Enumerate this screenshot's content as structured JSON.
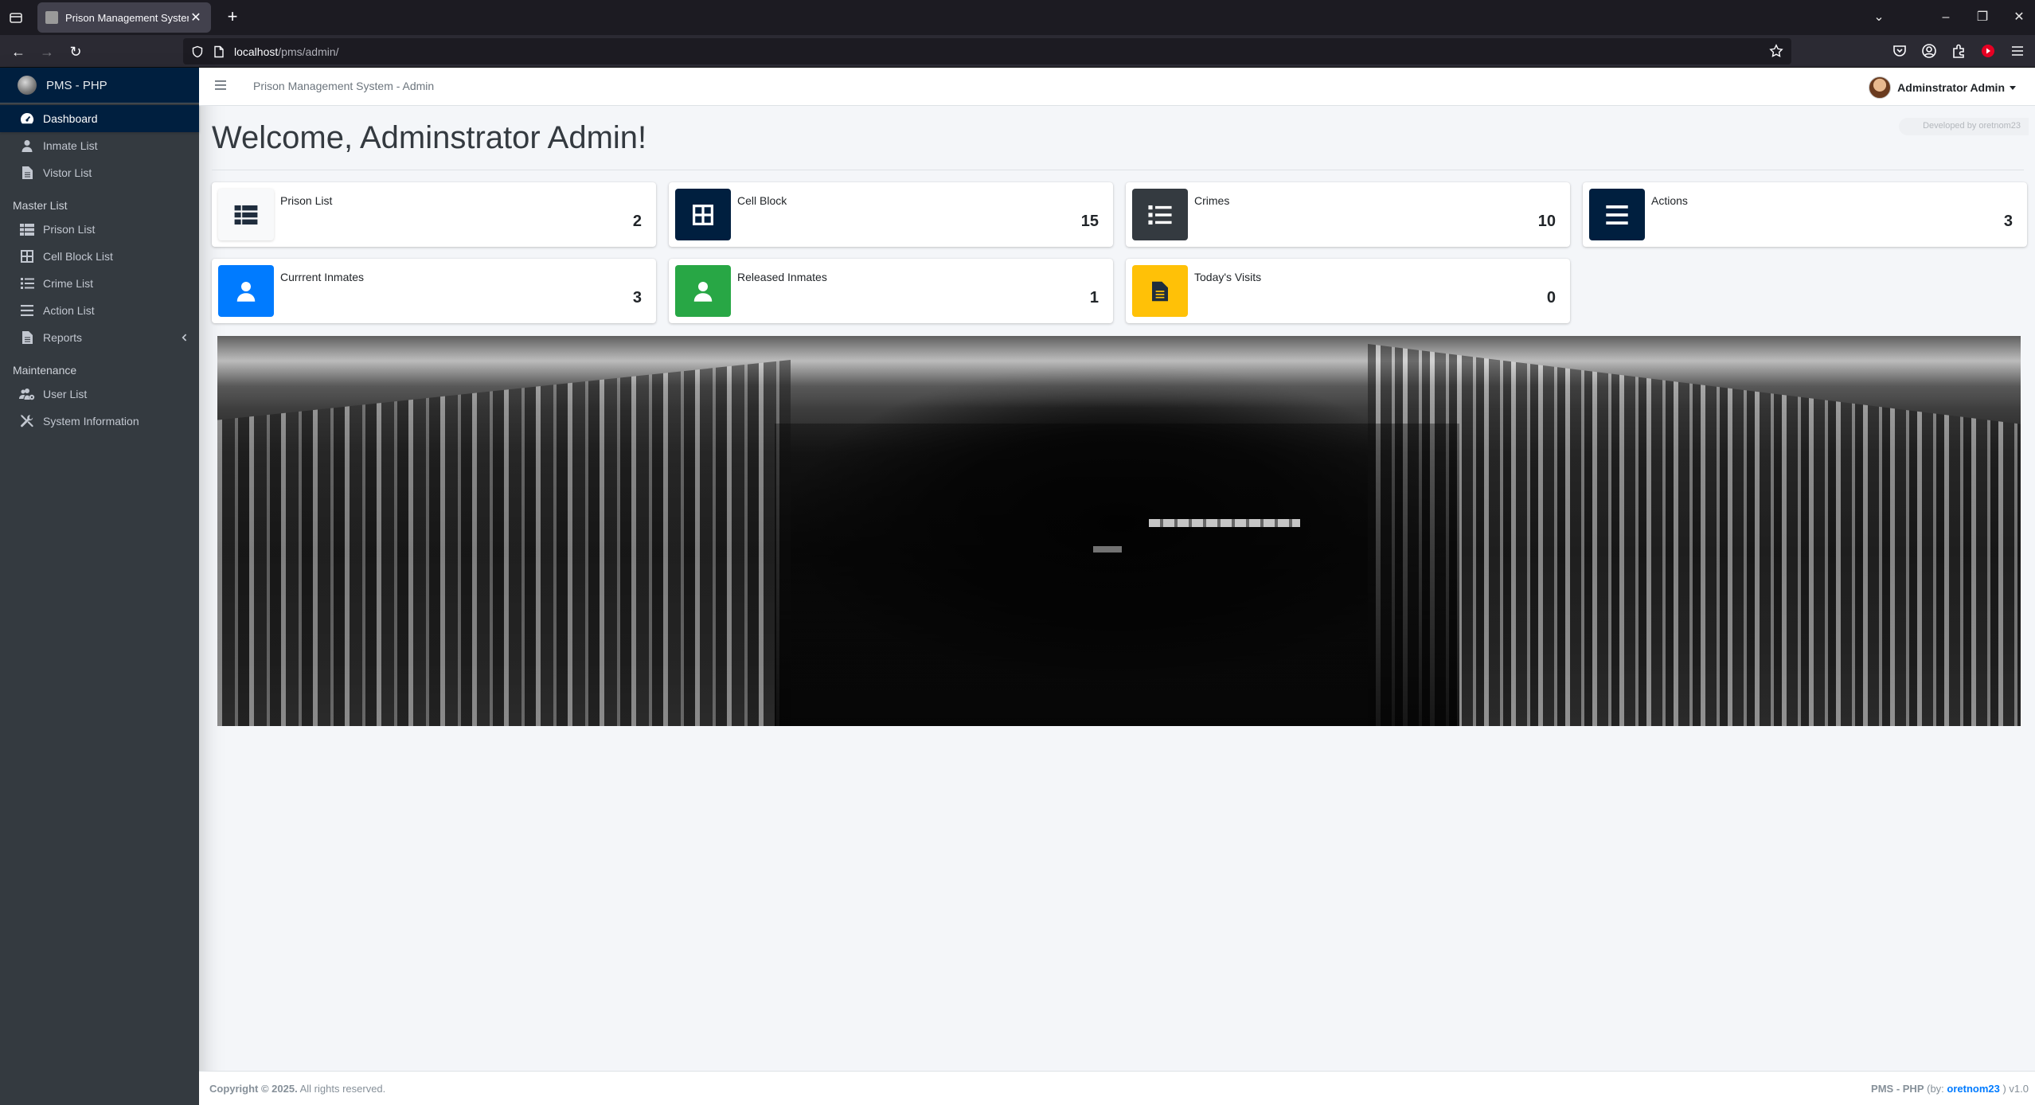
{
  "browser": {
    "tab_title": "Prison Management System",
    "url_host": "localhost",
    "url_path": "/pms/admin/"
  },
  "sidebar": {
    "brand": "PMS - PHP",
    "items": [
      {
        "label": "Dashboard",
        "icon": "tachometer-icon",
        "active": true
      },
      {
        "label": "Inmate List",
        "icon": "user-icon"
      },
      {
        "label": "Vistor List",
        "icon": "file-icon"
      }
    ],
    "master_header": "Master List",
    "master_items": [
      {
        "label": "Prison List",
        "icon": "table-icon"
      },
      {
        "label": "Cell Block List",
        "icon": "grid-icon"
      },
      {
        "label": "Crime List",
        "icon": "list-icon"
      },
      {
        "label": "Action List",
        "icon": "bars-icon"
      },
      {
        "label": "Reports",
        "icon": "file-icon"
      }
    ],
    "maintenance_header": "Maintenance",
    "maintenance_items": [
      {
        "label": "User List",
        "icon": "users-cog-icon"
      },
      {
        "label": "System Information",
        "icon": "tools-icon"
      }
    ]
  },
  "header": {
    "title": "Prison Management System - Admin",
    "user_name": "Adminstrator Admin"
  },
  "main": {
    "welcome": "Welcome, Adminstrator Admin!",
    "dev_badge": "Developed by oretnom23",
    "info_boxes": [
      {
        "label": "Prison List",
        "value": "2",
        "color": "#f8f9fa",
        "icon": "table-icon"
      },
      {
        "label": "Cell Block",
        "value": "15",
        "color": "#001f3f",
        "icon": "grid-icon"
      },
      {
        "label": "Crimes",
        "value": "10",
        "color": "#343a40",
        "icon": "list-icon"
      },
      {
        "label": "Actions",
        "value": "3",
        "color": "#001f3f",
        "icon": "bars-icon"
      },
      {
        "label": "Currrent Inmates",
        "value": "3",
        "color": "#007bff",
        "icon": "user-icon"
      },
      {
        "label": "Released Inmates",
        "value": "1",
        "color": "#28a745",
        "icon": "user-icon"
      },
      {
        "label": "Today's Visits",
        "value": "0",
        "color": "#ffc107",
        "icon": "file-icon"
      }
    ]
  },
  "footer": {
    "copyright_bold": "Copyright © 2025.",
    "copyright_rest": " All rights reserved.",
    "credits_app": "PMS - PHP",
    "credits_by": " (by: ",
    "credits_author": "oretnom23",
    "credits_end": " ) v1.0"
  }
}
